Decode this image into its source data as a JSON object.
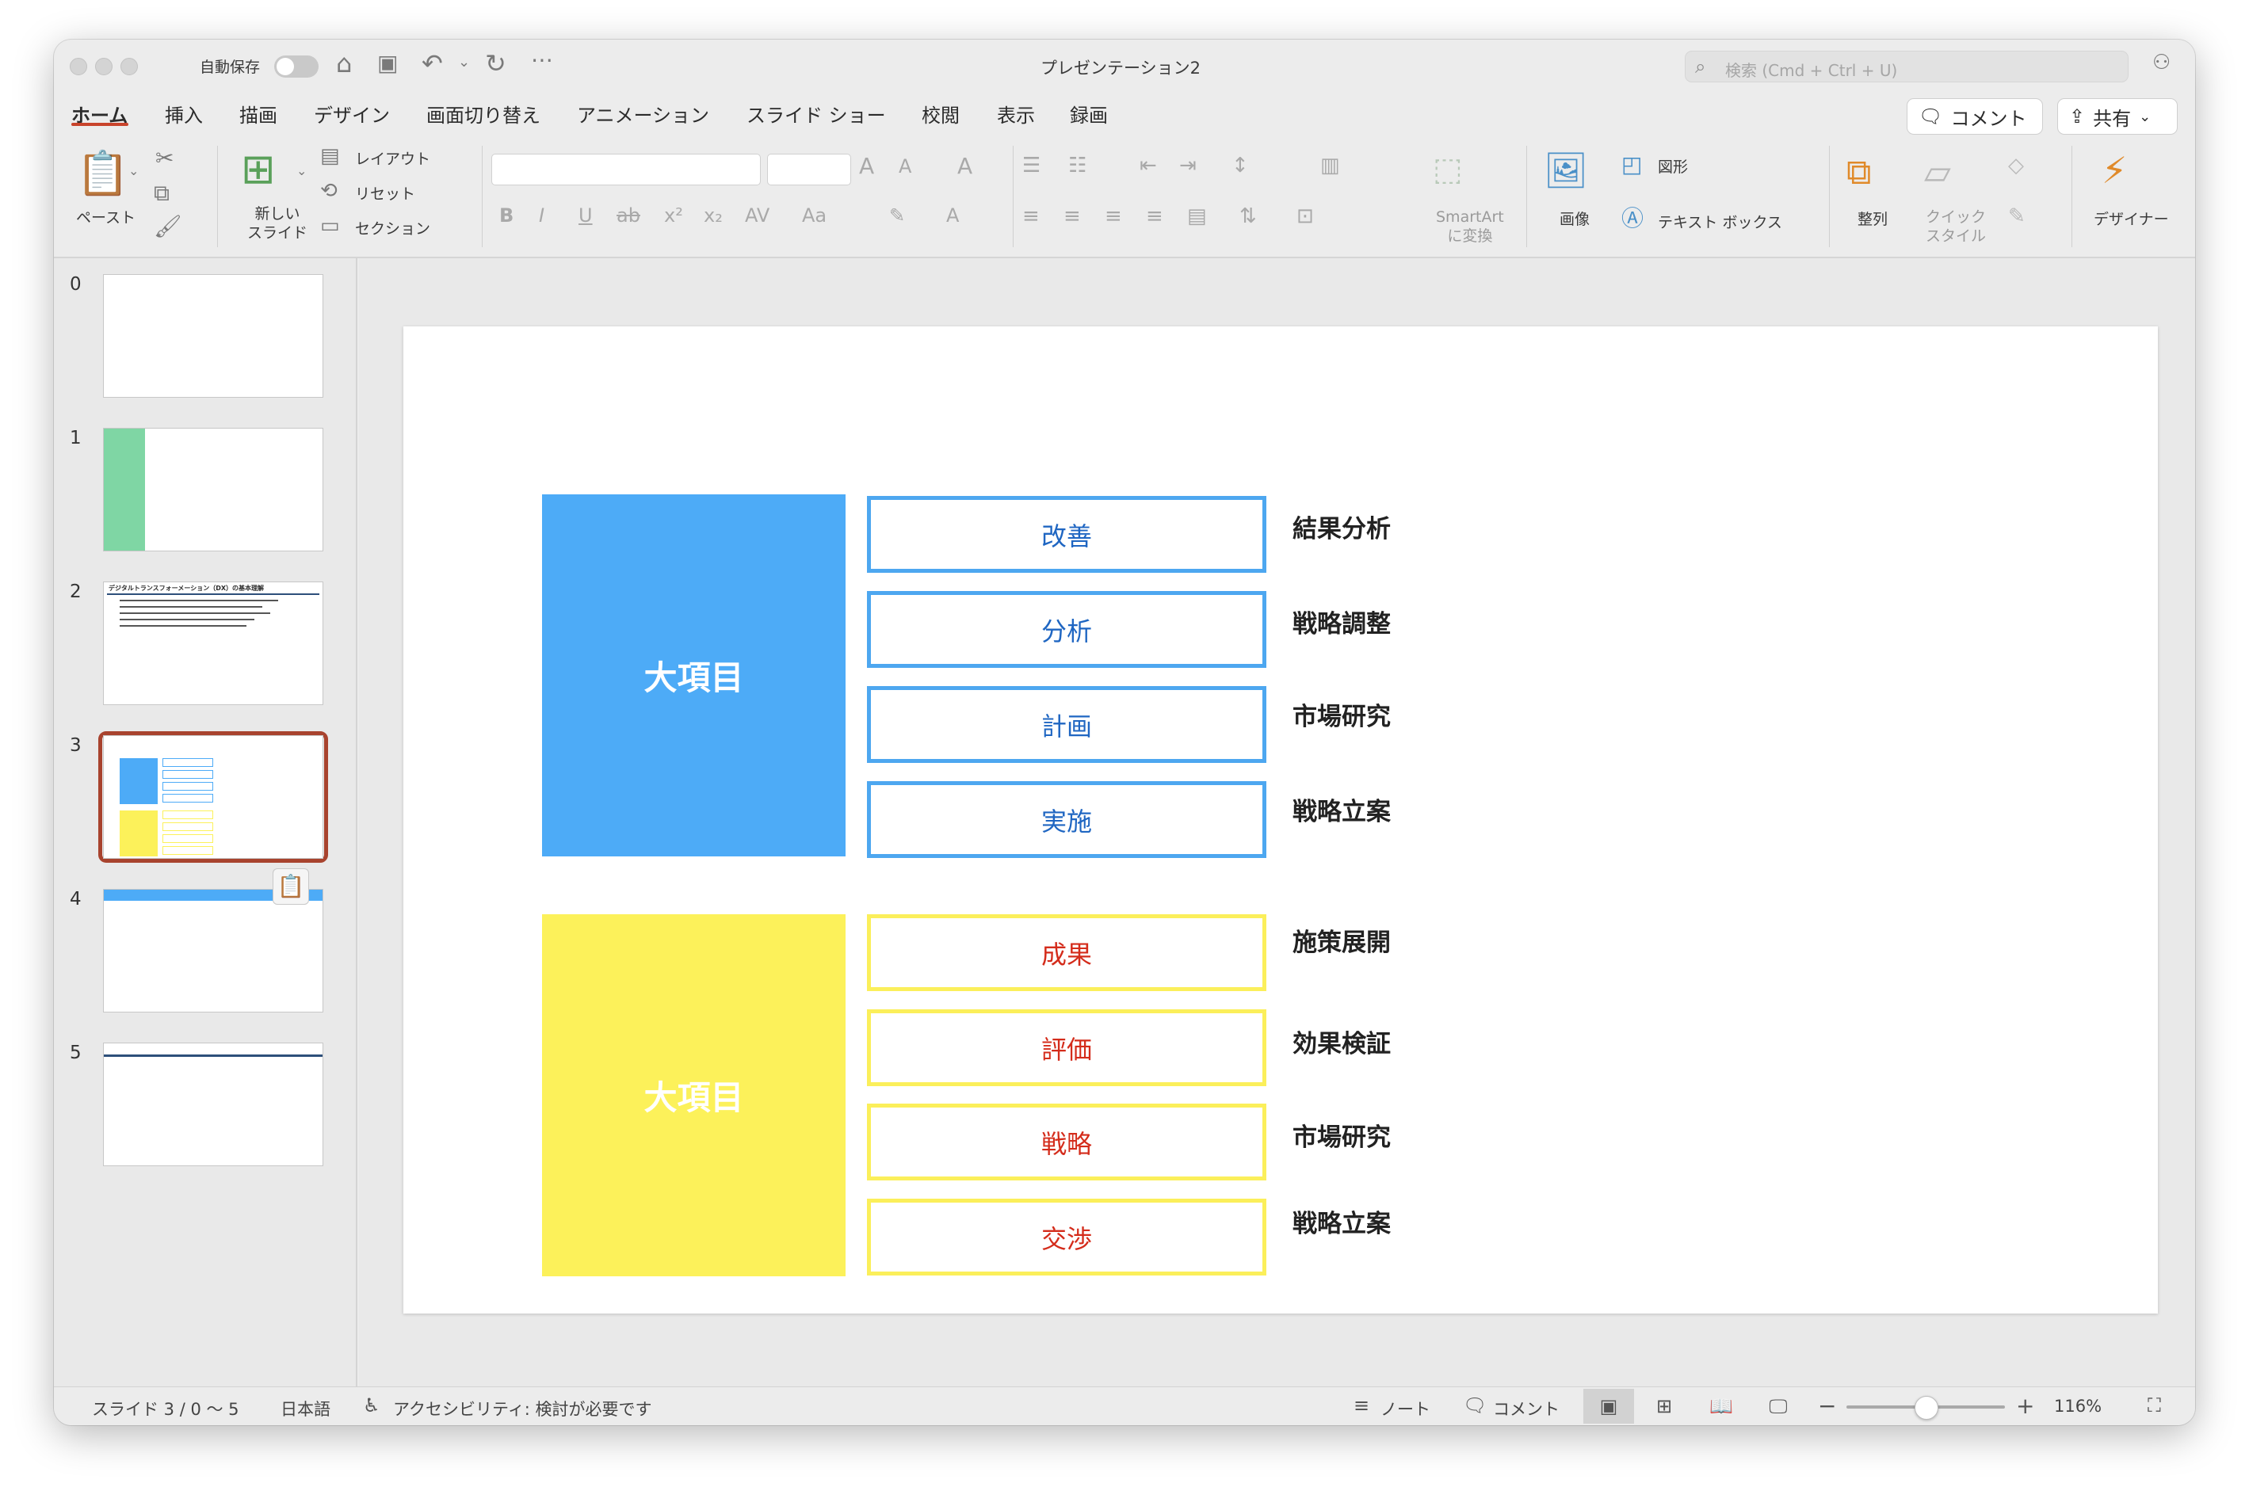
{
  "window": {
    "title": "プレゼンテーション2",
    "autosave_label": "自動保存"
  },
  "search": {
    "placeholder": "検索 (Cmd + Ctrl + U)"
  },
  "menu": {
    "tabs": [
      "ホーム",
      "挿入",
      "描画",
      "デザイン",
      "画面切り替え",
      "アニメーション",
      "スライド ショー",
      "校閲",
      "表示",
      "録画"
    ],
    "active": "ホーム"
  },
  "toolbar": {
    "comment_label": "コメント",
    "share_label": "共有"
  },
  "ribbon": {
    "paste": "ペースト",
    "new_slide": "新しい\nスライド",
    "layout": "レイアウト",
    "reset": "リセット",
    "section": "セクション",
    "smartart": "SmartArt\nに変換",
    "image": "画像",
    "shapes": "図形",
    "textbox": "テキスト ボックス",
    "arrange": "整列",
    "quick_style": "クイック\nスタイル",
    "designer": "デザイナー"
  },
  "thumbnails": {
    "numbers": [
      "0",
      "1",
      "2",
      "3",
      "4",
      "5"
    ],
    "slide2_title": "デジタルトランスフォーメーション（DX）の基本理解",
    "selected_index": 3
  },
  "slide": {
    "groups": [
      {
        "title": "大項目",
        "color": "#4dabf7",
        "items": [
          "改善",
          "分析",
          "計画",
          "実施"
        ],
        "right": [
          "結果分析",
          "戦略調整",
          "市場研究",
          "戦略立案"
        ]
      },
      {
        "title": "大項目",
        "color": "#fcf15a",
        "items": [
          "成果",
          "評価",
          "戦略",
          "交渉"
        ],
        "right": [
          "施策展開",
          "効果検証",
          "市場研究",
          "戦略立案"
        ]
      }
    ]
  },
  "status": {
    "slide_info": "スライド 3 / 0 〜 5",
    "language": "日本語",
    "accessibility": "アクセシビリティ: 検討が必要です",
    "notes": "ノート",
    "comments": "コメント",
    "zoom": "116%"
  }
}
